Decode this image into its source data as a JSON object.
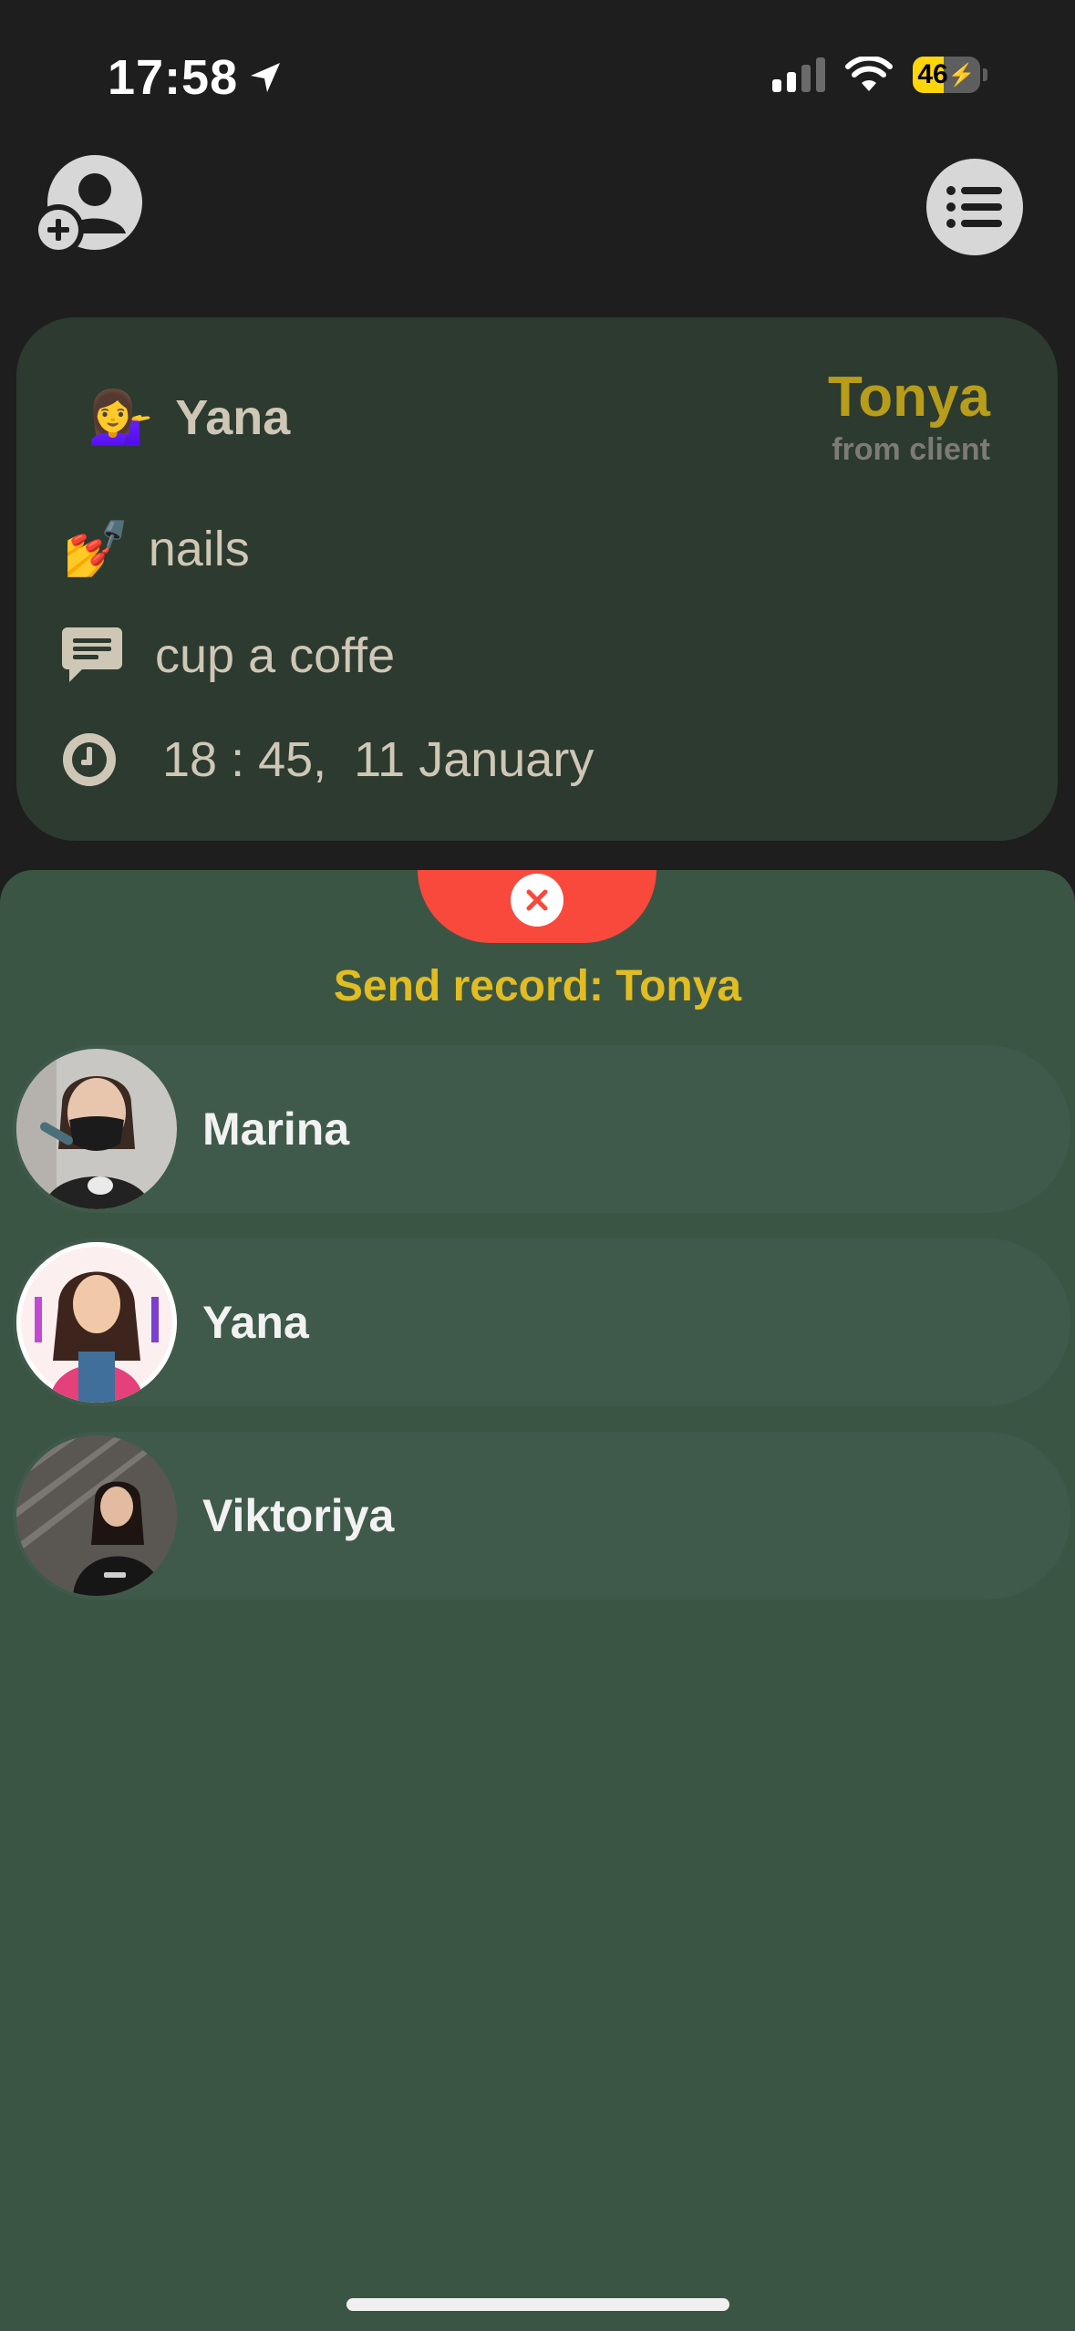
{
  "status_bar": {
    "time": "17:58",
    "battery": "46"
  },
  "record": {
    "master_emoji": "💁‍♀️",
    "master_name": "Yana",
    "client_name": "Tonya",
    "client_source": "from client",
    "service_emoji": "💅",
    "service": "nails",
    "comment": "cup a coffe",
    "time": "18 : 45,  11 January"
  },
  "sheet": {
    "title": "Send record: Tonya",
    "masters": [
      {
        "name": "Marina"
      },
      {
        "name": "Yana"
      },
      {
        "name": "Viktoriya"
      }
    ]
  }
}
